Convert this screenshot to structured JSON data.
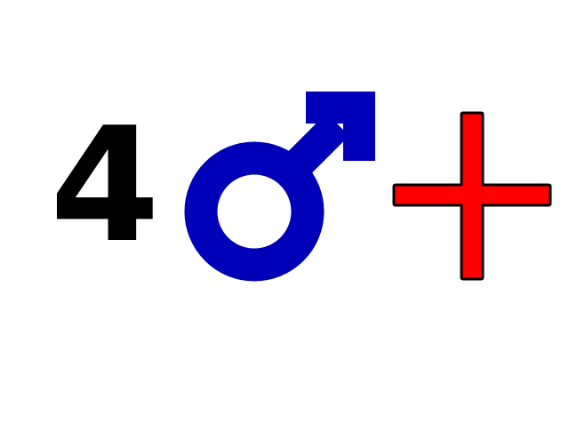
{
  "glyphs": {
    "digit": {
      "text": "4",
      "color": "#000000"
    },
    "male_symbol": {
      "icon": "male-symbol-icon",
      "color": "#0000B8"
    },
    "plus_sign": {
      "icon": "plus-icon",
      "fill": "#FF0000",
      "stroke": "#000000"
    }
  }
}
